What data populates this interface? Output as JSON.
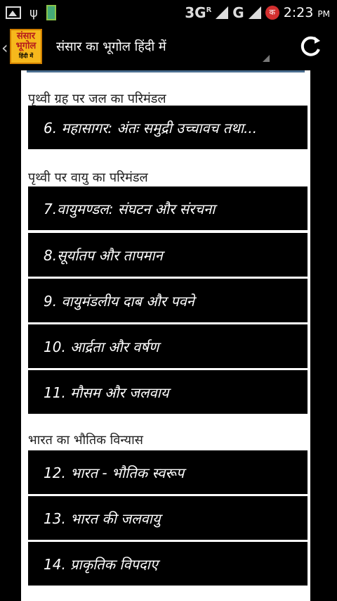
{
  "status_bar": {
    "network": "3G",
    "network_sup": "R",
    "network2": "G",
    "rec_label": "क",
    "time": "2:23",
    "ampm": "PM"
  },
  "header": {
    "logo": {
      "line1": "संसार",
      "line2": "भूगोल",
      "line3": "हिंदी में"
    },
    "title": "संसार का भूगोल हिंदी में"
  },
  "sections": [
    {
      "heading": "पृथ्वी ग्रह पर जल का परिमंडल",
      "items": [
        "6. महासागर: अंतः समुद्री उच्चावच तथा..."
      ]
    },
    {
      "heading": "पृथ्वी पर वायु का परिमंडल",
      "items": [
        "7.वायुमण्डल: संघटन और संरचना",
        "8.सूर्यातप और तापमान",
        "9. वायुमंडलीय दाब और पवने",
        "10. आर्द्रता और वर्षण",
        "11. मौसम और जलवाय"
      ]
    },
    {
      "heading": "भारत का भौतिक विन्यास",
      "items": [
        "12. भारत - भौतिक स्वरूप",
        "13. भारत की जलवायु",
        "14. प्राकृतिक विपदाए"
      ]
    }
  ],
  "icons": {
    "refresh": "refresh-icon",
    "back": "back-chevron-icon"
  }
}
